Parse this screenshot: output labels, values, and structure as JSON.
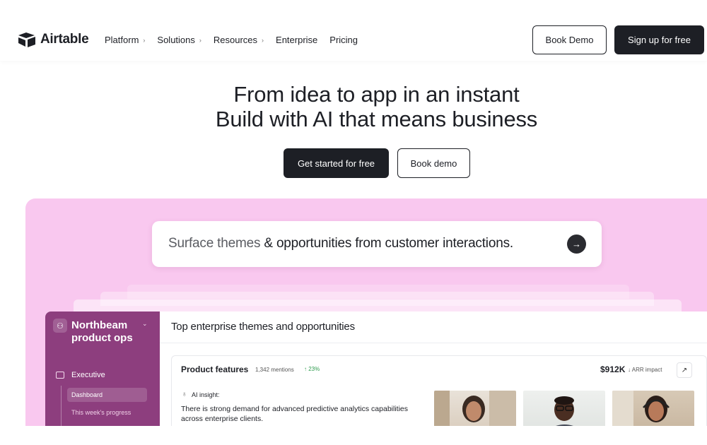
{
  "brand": {
    "name": "Airtable"
  },
  "nav": {
    "links": [
      {
        "label": "Platform",
        "chevron": true
      },
      {
        "label": "Solutions",
        "chevron": true
      },
      {
        "label": "Resources",
        "chevron": true
      },
      {
        "label": "Enterprise",
        "chevron": false
      },
      {
        "label": "Pricing",
        "chevron": false
      }
    ],
    "book_demo": "Book Demo",
    "signup": "Sign up for free"
  },
  "hero": {
    "line1": "From idea to app in an instant",
    "line2": "Build with AI that means business",
    "cta_primary": "Get started for free",
    "cta_secondary": "Book demo"
  },
  "prompt": {
    "text_muted_1": "Surface themes",
    "amp": "&",
    "text_dark": "opportunities from customer interactions.",
    "send_icon": "arrow-right-icon"
  },
  "app": {
    "workspace_name": "Northbeam product ops",
    "sidebar": {
      "section": "Executive",
      "items": [
        "Dashboard",
        "This week's progress"
      ]
    },
    "main_title": "Top enterprise themes and opportunities",
    "card": {
      "title": "Product features",
      "mentions": "1,342 mentions",
      "growth": "↑ 23%",
      "amount": "$912K",
      "impact": "↓ ARR impact",
      "expand_icon": "↗",
      "ai_label": "AI insight:",
      "ai_text": "There is strong demand for advanced predictive analytics capabilities across enterprise clients."
    }
  },
  "colors": {
    "dark": "#1d1f25",
    "pink_panel": "#f9c8ef",
    "sidebar_purple": "#8d3e7e",
    "growth_green": "#2e9b4e"
  }
}
